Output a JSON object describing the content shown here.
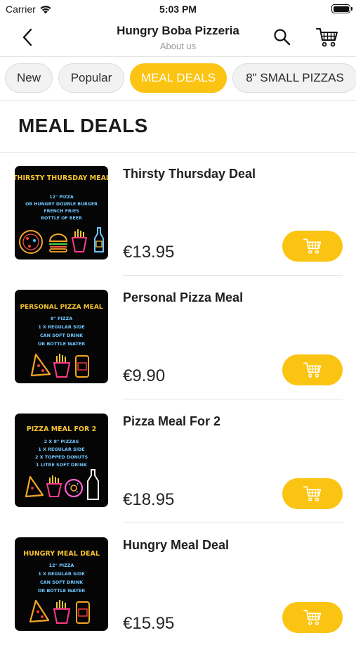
{
  "status_bar": {
    "carrier": "Carrier",
    "time": "5:03 PM"
  },
  "header": {
    "title": "Hungry Boba Pizzeria",
    "subtitle": "About us"
  },
  "tabs": [
    {
      "label": "New",
      "active": false
    },
    {
      "label": "Popular",
      "active": false
    },
    {
      "label": "MEAL DEALS",
      "active": true
    },
    {
      "label": "8\" SMALL PIZZAS",
      "active": false
    }
  ],
  "section": {
    "title": "MEAL DEALS"
  },
  "items": [
    {
      "name": "Thirsty Thursday Deal",
      "price": "€13.95",
      "image": {
        "heading": "THIRSTY THURSDAY MEAL",
        "lines": [
          "12\" PIZZA",
          "OR HUNGRY DOUBLE BURGER",
          "FRENCH FRIES",
          "BOTTLE OF BEER"
        ],
        "icons": [
          "pizza-icon",
          "burger-icon",
          "fries-icon",
          "beer-bottle-icon"
        ]
      }
    },
    {
      "name": "Personal Pizza Meal",
      "price": "€9.90",
      "image": {
        "heading": "PERSONAL PIZZA MEAL",
        "lines": [
          "8\" PIZZA",
          "1 X REGULAR SIDE",
          "CAN SOFT DRINK",
          "OR BOTTLE WATER"
        ],
        "icons": [
          "pizza-slice-icon",
          "fries-icon",
          "soda-can-icon"
        ]
      }
    },
    {
      "name": "Pizza Meal For 2",
      "price": "€18.95",
      "image": {
        "heading": "PIZZA MEAL FOR 2",
        "lines": [
          "2 X 8\" PIZZAS",
          "1 X REGULAR SIDE",
          "2 X TOPPED DONUTS",
          "1 LITRE SOFT DRINK"
        ],
        "icons": [
          "pizza-slice-icon",
          "fries-icon",
          "donut-icon",
          "water-bottle-icon"
        ]
      }
    },
    {
      "name": "Hungry Meal Deal",
      "price": "€15.95",
      "image": {
        "heading": "HUNGRY MEAL DEAL",
        "lines": [
          "12\" PIZZA",
          "1 X REGULAR SIDE",
          "CAN SOFT DRINK",
          "OR BOTTLE WATER"
        ],
        "icons": [
          "pizza-slice-icon",
          "fries-icon",
          "soda-can-icon"
        ]
      }
    }
  ],
  "colors": {
    "accent": "#fcc412",
    "neon_heading": "#f6c431",
    "neon_text": "#6ec6ff"
  }
}
